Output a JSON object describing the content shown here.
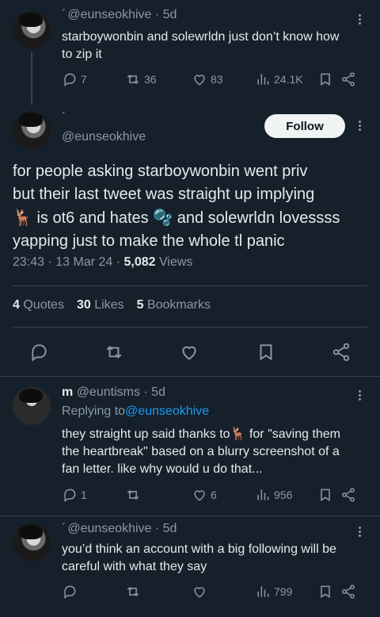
{
  "tweet1": {
    "handle": "@eunseokhive",
    "time": "5d",
    "text_line1": "starboywonbin and solewrldn just don’t know how",
    "text_line2": "to zip it",
    "replies": "7",
    "retweets": "36",
    "likes": "83",
    "views": "24.1K"
  },
  "main": {
    "name_mark": "´",
    "handle": "@eunseokhive",
    "follow_label": "Follow",
    "line1": "for people asking starboywonbin went priv",
    "line2": "but their last tweet was straight up implying",
    "line3_a": "🦌",
    "line3_b": " is ot6 and hates ",
    "line3_c": "🫧",
    "line3_d": " and solewrldn lovessss",
    "line4": "yapping just to make the whole tl panic",
    "time": "23:43",
    "date": "13 Mar 24",
    "views_count": "5,082",
    "views_label": "Views",
    "quotes_count": "4",
    "quotes_label": "Quotes",
    "likes_count": "30",
    "likes_label": "Likes",
    "bookmarks_count": "5",
    "bookmarks_label": "Bookmarks"
  },
  "reply1": {
    "name": "m",
    "handle": "@euntisms",
    "time": "5d",
    "replying_to_label": "Replying to ",
    "replying_to_handle": "@eunseokhive",
    "line1_a": "they straight up said thanks to",
    "line1_emoji": "🦌",
    "line1_b": " for \"saving them",
    "line2": "the heartbreak\" based on a blurry screenshot of a",
    "line3": "fan letter. like why would u do that...",
    "replies": "1",
    "likes": "6",
    "views": "956"
  },
  "reply2": {
    "handle": "@eunseokhive",
    "time": "5d",
    "line1": "you’d think an account with a big following will be",
    "line2": "careful with what they say",
    "views": "799"
  },
  "icons": {
    "reply": "reply-icon",
    "retweet": "retweet-icon",
    "like": "heart-icon",
    "views": "views-icon",
    "bookmark": "bookmark-icon",
    "share": "share-icon",
    "more": "more-icon"
  }
}
